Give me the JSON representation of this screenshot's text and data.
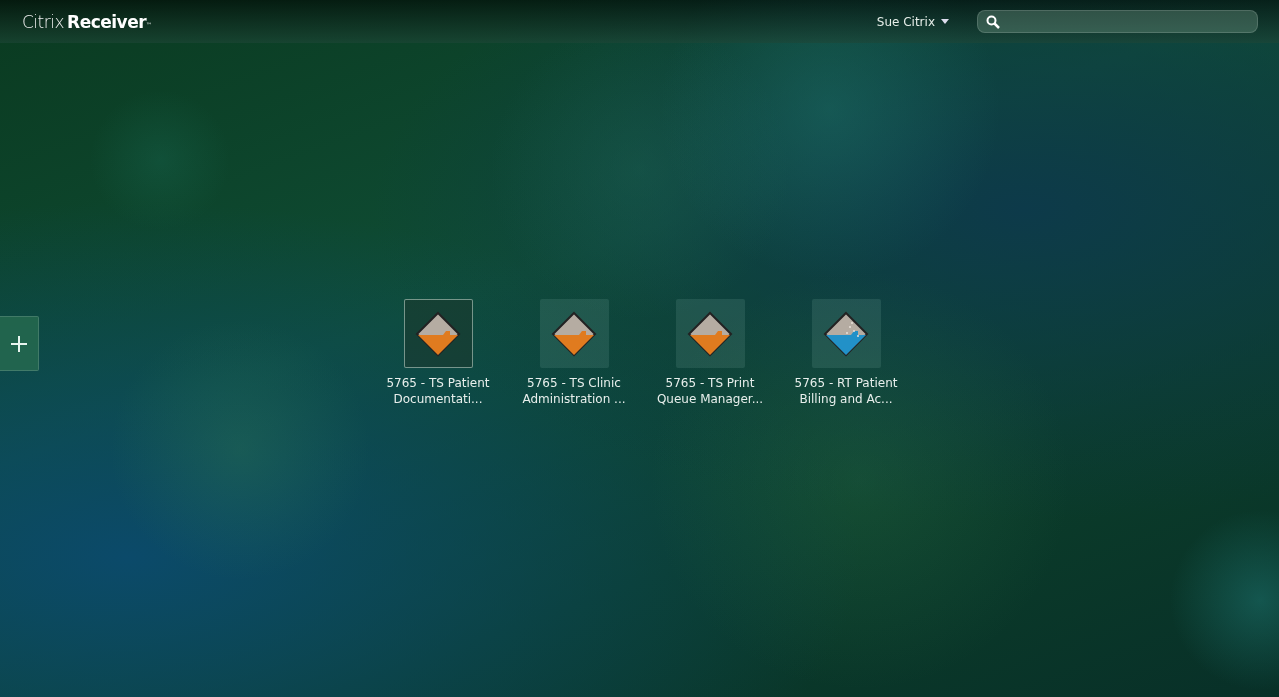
{
  "header": {
    "logo": {
      "light": "Citrix",
      "bold": "Receiver",
      "mark": "™"
    },
    "user_menu": {
      "label": "Sue Citrix"
    }
  },
  "apps": [
    {
      "line1": "5765 - TS Patient",
      "line2": "Documentati...",
      "selected": true,
      "kind": "plain",
      "color": "#e07b1f"
    },
    {
      "line1": "5765 - TS Clinic",
      "line2": "Administration ...",
      "selected": false,
      "kind": "plain",
      "color": "#e07b1f"
    },
    {
      "line1": "5765 - TS Print",
      "line2": "Queue Manager...",
      "selected": false,
      "kind": "plain",
      "color": "#e07b1f"
    },
    {
      "line1": "5765 - RT Patient",
      "line2": "Billing and Ac...",
      "selected": false,
      "kind": "speckled",
      "color": "#2291c8"
    }
  ]
}
